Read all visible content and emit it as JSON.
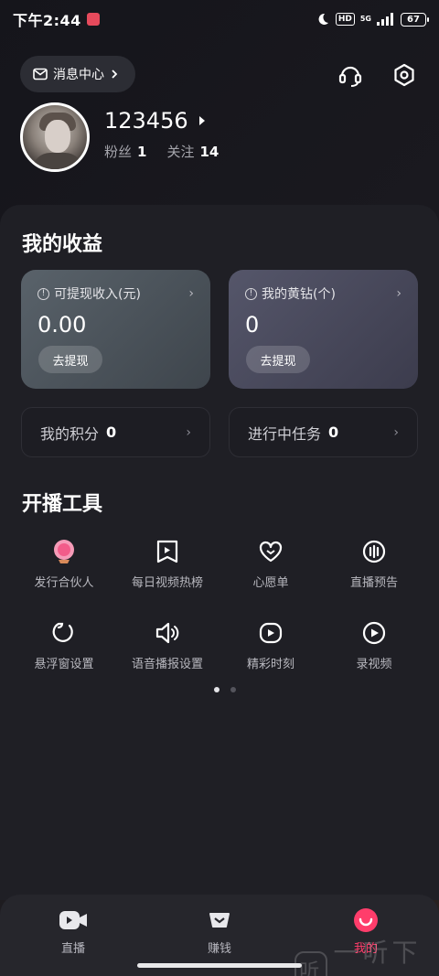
{
  "status_bar": {
    "time": "下午2:44",
    "hd": "HD",
    "network": "5G",
    "battery": "67"
  },
  "header": {
    "message_center_label": "消息中心",
    "username": "123456",
    "fans_label": "粉丝",
    "fans_count": "1",
    "following_label": "关注",
    "following_count": "14"
  },
  "earnings": {
    "title": "我的收益",
    "cards": [
      {
        "label": "可提现收入(元)",
        "value": "0.00",
        "button": "去提现"
      },
      {
        "label": "我的黄钻(个)",
        "value": "0",
        "button": "去提现"
      }
    ],
    "stats": [
      {
        "label": "我的积分",
        "value": "0"
      },
      {
        "label": "进行中任务",
        "value": "0"
      }
    ]
  },
  "tools": {
    "title": "开播工具",
    "items": [
      {
        "label": "发行合伙人",
        "icon": "partner-icon"
      },
      {
        "label": "每日视频热榜",
        "icon": "bookmark-play-icon"
      },
      {
        "label": "心愿单",
        "icon": "heart-icon"
      },
      {
        "label": "直播预告",
        "icon": "live-preview-icon"
      },
      {
        "label": "悬浮窗设置",
        "icon": "float-window-icon"
      },
      {
        "label": "语音播报设置",
        "icon": "speaker-icon"
      },
      {
        "label": "精彩时刻",
        "icon": "highlight-play-icon"
      },
      {
        "label": "录视频",
        "icon": "record-video-icon"
      }
    ]
  },
  "bottom_nav": [
    {
      "label": "直播",
      "icon": "live-camera-icon"
    },
    {
      "label": "赚钱",
      "icon": "earn-icon"
    },
    {
      "label": "我的",
      "icon": "profile-smile-icon",
      "active": true
    }
  ],
  "watermark": "一听下载",
  "watermark_logo": "听",
  "colors": {
    "accent": "#ff3d6b",
    "background": "#1b1b20",
    "card_left": "#4a5259",
    "card_right": "#4a4a5c"
  }
}
